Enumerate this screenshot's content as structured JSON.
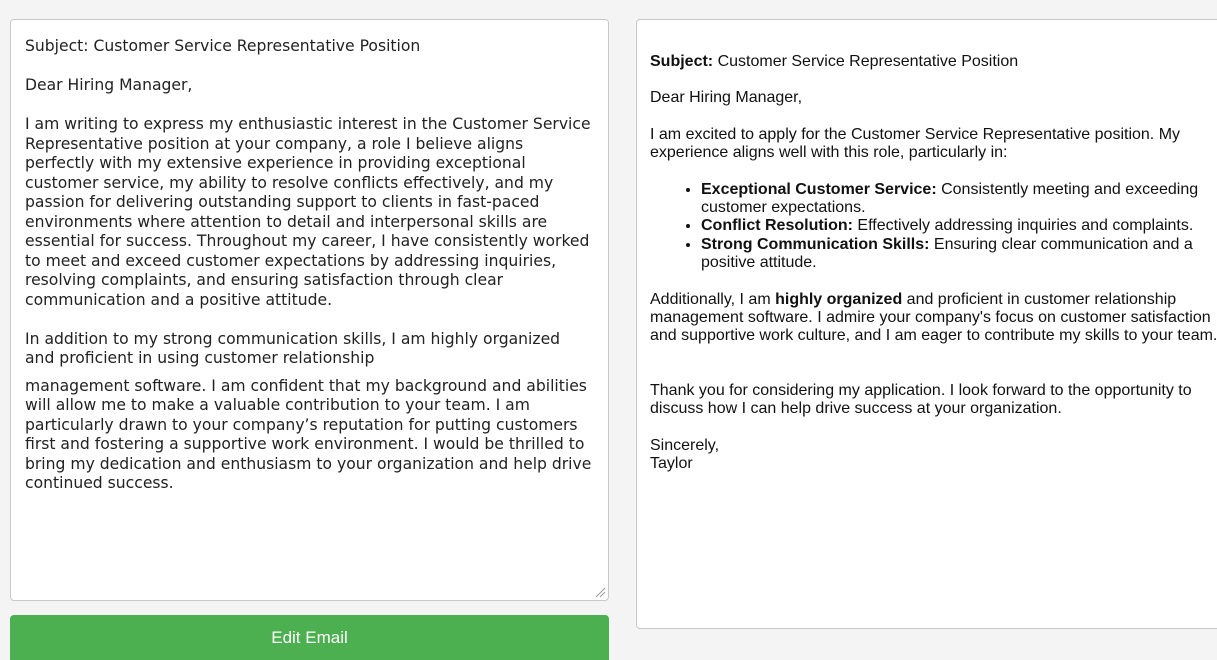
{
  "source": {
    "paragraphs": [
      "Subject: Customer Service Representative Position",
      "Dear Hiring Manager,",
      "I am writing to express my enthusiastic interest in the Customer Service Representative position at your company, a role I believe aligns perfectly with my extensive experience in providing exceptional customer service, my ability to resolve conflicts effectively, and my passion for delivering outstanding support to clients in fast-paced environments where attention to detail and interpersonal skills are essential for success. Throughout my career, I have consistently worked to meet and exceed customer expectations by addressing inquiries, resolving complaints, and ensuring satisfaction through clear communication and a positive attitude.",
      "In addition to my strong communication skills, I am highly organized and proficient in using customer relationship",
      "management software. I am confident that my background and abilities will allow me to make a valuable contribution to your team. I am particularly drawn to your company’s reputation for putting customers first and fostering a supportive work environment. I would be thrilled to bring my dedication and enthusiasm to your organization and help drive continued success."
    ]
  },
  "edit_button_label": "Edit Email",
  "preview": {
    "subject_label": "Subject:",
    "subject_text": " Customer Service Representative Position",
    "greeting": "Dear Hiring Manager,",
    "intro": "I am excited to apply for the Customer Service Representative position. My experience aligns well with this role, particularly in:",
    "bullets": [
      {
        "bold": "Exceptional Customer Service:",
        "text": " Consistently meeting and exceeding customer expectations."
      },
      {
        "bold": "Conflict Resolution:",
        "text": " Effectively addressing inquiries and complaints."
      },
      {
        "bold": "Strong Communication Skills:",
        "text": " Ensuring clear communication and a positive attitude."
      }
    ],
    "additional_before": "Additionally, I am ",
    "additional_bold": "highly organized",
    "additional_after": " and proficient in customer relationship management software. I admire your company's focus on customer satisfaction and supportive work culture, and I am eager to contribute my skills to your team.",
    "closing_paragraph": "Thank you for considering my application. I look forward to the opportunity to discuss how I can help drive success at your organization.",
    "signoff": "Sincerely,",
    "signature": "Taylor"
  },
  "colors": {
    "button_bg": "#4caf50",
    "page_bg": "#f4f4f4"
  }
}
